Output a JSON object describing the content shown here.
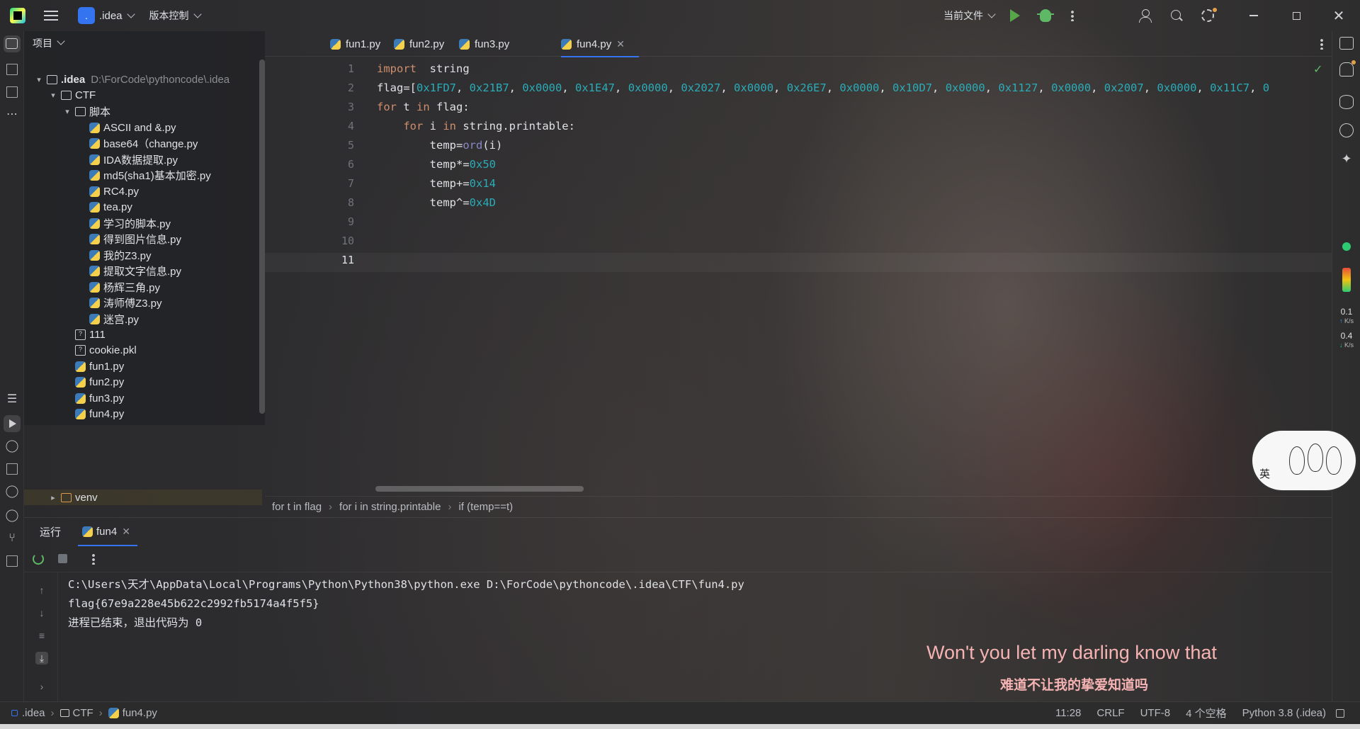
{
  "titlebar": {
    "project_badge": ".",
    "project_name": ".idea",
    "vcs_label": "版本控制",
    "current_file_label": "当前文件"
  },
  "project_panel": {
    "title": "项目",
    "root": {
      "name": ".idea",
      "path": "D:\\ForCode\\pythoncode\\.idea"
    },
    "folders": {
      "ctf": "CTF",
      "scripts": "脚本",
      "venv": "venv"
    },
    "script_files": [
      "ASCII and &.py",
      "base64（change.py",
      "IDA数据提取.py",
      "md5(sha1)基本加密.py",
      "RC4.py",
      "tea.py",
      "学习的脚本.py",
      "得到图片信息.py",
      "我的Z3.py",
      "提取文字信息.py",
      "杨辉三角.py",
      "涛师傅Z3.py",
      "迷宫.py"
    ],
    "ctf_files": [
      "111",
      "cookie.pkl",
      "fun1.py",
      "fun2.py",
      "fun3.py",
      "fun4.py"
    ]
  },
  "editor": {
    "tabs": [
      "fun1.py",
      "fun2.py",
      "fun3.py",
      "fun4.py"
    ],
    "active_tab": "fun4.py",
    "line_numbers": [
      "1",
      "2",
      "3",
      "4",
      "5",
      "6",
      "7",
      "8",
      "9",
      "10",
      "11"
    ],
    "breadcrumbs": [
      "for t in flag",
      "for i in string.printable",
      "if (temp==t)"
    ]
  },
  "run_panel": {
    "title": "运行",
    "tab": "fun4",
    "output": [
      "C:\\Users\\天才\\AppData\\Local\\Programs\\Python\\Python38\\python.exe D:\\ForCode\\pythoncode\\.idea\\CTF\\fun4.py",
      "flag{67e9a228e45b622c2992fb5174a4f5f5}",
      "进程已结束，退出代码为 0"
    ]
  },
  "right_strip": {
    "net_up": "0.1",
    "net_down": "0.4",
    "net_unit": "K/s"
  },
  "sticker": {
    "text": "英"
  },
  "subtitle": {
    "english": "Won't you let my darling know that",
    "chinese": "难道不让我的挚爱知道吗"
  },
  "statusbar": {
    "path": [
      ".idea",
      "CTF",
      "fun4.py"
    ],
    "position": "11:28",
    "line_ending": "CRLF",
    "encoding": "UTF-8",
    "indent": "4 个空格",
    "interpreter": "Python 3.8 (.idea)"
  },
  "colors": {
    "accent": "#3574f0",
    "keyword": "#cf8e6d",
    "number": "#2aacb8",
    "string": "#6aab73",
    "run_green": "#57a64a",
    "subtitle_pink": "#f6b3b3"
  },
  "icons": {
    "toolbar": [
      "menu-icon",
      "run-icon",
      "debug-icon",
      "more-icon",
      "add-user-icon",
      "search-icon",
      "settings-icon"
    ],
    "left_strip": [
      "project-icon",
      "structure-icon",
      "bookmarks-icon",
      "more-tools-icon",
      "todo-icon",
      "run-tool-icon",
      "python-console-icon",
      "layers-icon",
      "services-icon",
      "problems-icon",
      "git-icon",
      "terminal-icon"
    ],
    "right_strip": [
      "notifications-icon",
      "database-icon",
      "sciview-icon",
      "ai-assistant-icon"
    ]
  }
}
